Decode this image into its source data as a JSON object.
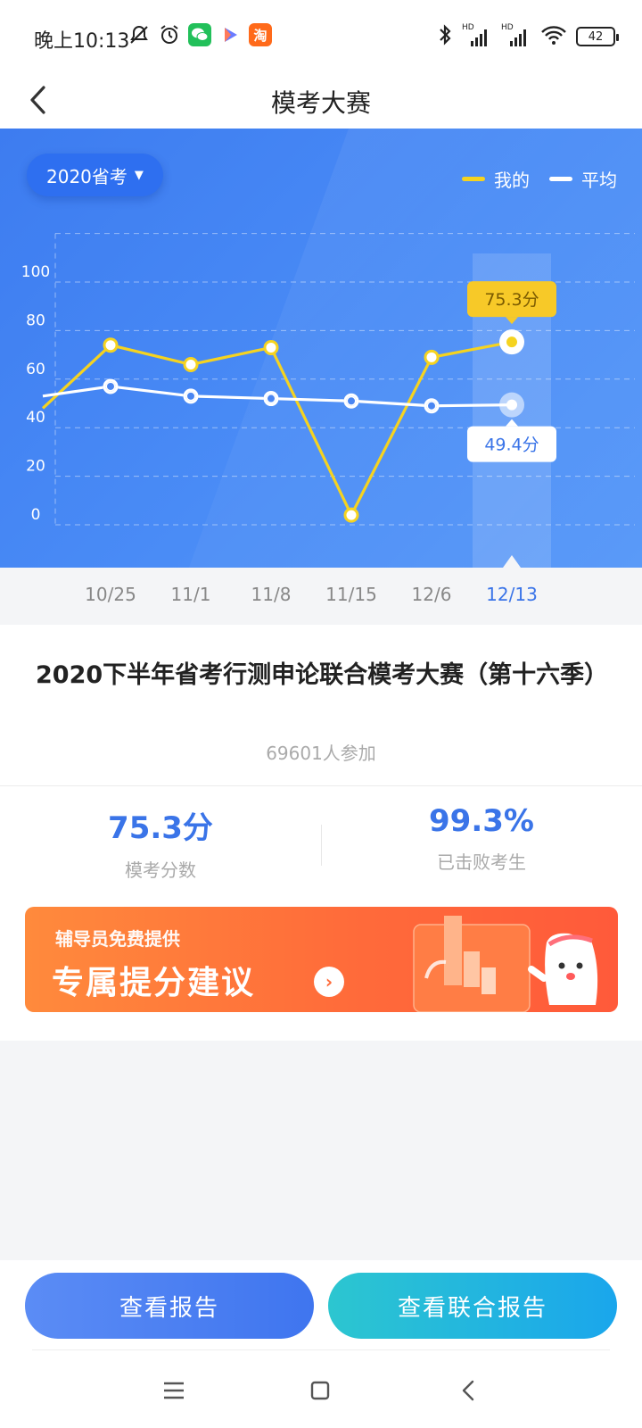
{
  "status_bar": {
    "time": "晚上10:13",
    "icons_left": [
      "mute-alarm-icon",
      "alarm-icon",
      "wechat-icon",
      "play-icon",
      "taobao-icon"
    ],
    "taobao_glyph": "淘",
    "hd1": "HD",
    "hd2": "HD",
    "battery": "42"
  },
  "header": {
    "title": "模考大赛"
  },
  "chart_controls": {
    "exam_select": "2020省考",
    "legend_mine": "我的",
    "legend_avg": "平均",
    "color_mine": "#f5d320",
    "color_avg": "#ffffff"
  },
  "chart_data": {
    "type": "line",
    "categories": [
      "10/25",
      "11/1",
      "11/8",
      "11/15",
      "12/6",
      "12/13"
    ],
    "y_ticks": [
      "100",
      "80",
      "60",
      "40",
      "20",
      "0"
    ],
    "ylim": [
      0,
      110
    ],
    "series": [
      {
        "name": "我的",
        "values": [
          74,
          66,
          73,
          4,
          69,
          75.3
        ],
        "color": "#f5d320"
      },
      {
        "name": "平均",
        "values": [
          57,
          53,
          52,
          51,
          49,
          49.4
        ],
        "color": "#ffffff"
      }
    ],
    "left_partial": {
      "mine": 48,
      "avg": 53
    },
    "selected_index": 5,
    "callout_mine": "75.3分",
    "callout_avg": "49.4分"
  },
  "contest": {
    "title": "2020下半年省考行测申论联合模考大赛（第十六季）",
    "participants": "69601人参加"
  },
  "stats": {
    "score_value": "75.3分",
    "score_label": "模考分数",
    "beat_value": "99.3%",
    "beat_label": "已击败考生"
  },
  "banner": {
    "subtitle": "辅导员免费提供",
    "main": "专属提分建议",
    "arrow": "›"
  },
  "buttons": {
    "view_report": "查看报告",
    "view_joint_report": "查看联合报告"
  },
  "system_nav": {
    "menu": "menu-icon",
    "home": "home-icon",
    "back": "back-icon"
  }
}
